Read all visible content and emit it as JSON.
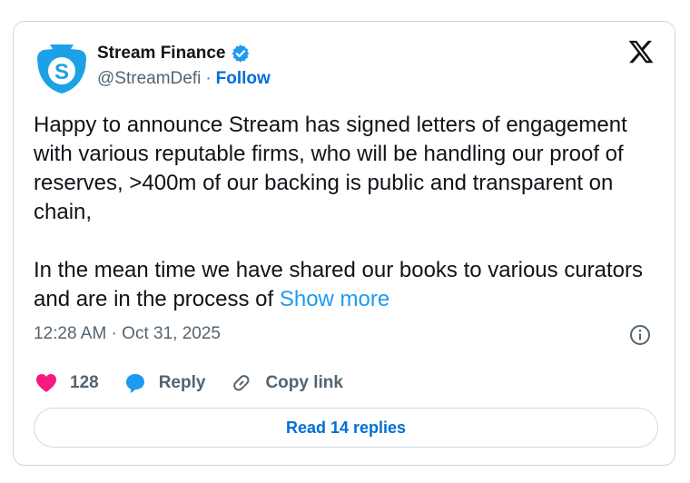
{
  "author": {
    "name": "Stream Finance",
    "handle": "@StreamDefi",
    "separator": "·",
    "follow_label": "Follow",
    "avatar_icon": "stream-finance-logo",
    "verified_icon": "verified-badge-icon"
  },
  "tweet": {
    "paragraph1": "Happy to announce Stream has signed letters of engagement with various reputable firms, who will be handling our proof of reserves, >400m of our backing is public and transparent on chain,",
    "paragraph2": "In the mean time we have shared our books to various curators and are in the process of ",
    "show_more": "Show more"
  },
  "meta": {
    "timestamp": "12:28 AM · Oct 31, 2025"
  },
  "actions": {
    "likes": "128",
    "reply_label": "Reply",
    "copy_link_label": "Copy link"
  },
  "read_replies_label": "Read 14 replies",
  "colors": {
    "accent": "#1d9bf0",
    "link": "#006fd6",
    "heart": "#f91880",
    "muted": "#536471",
    "border": "#cfd9de"
  }
}
